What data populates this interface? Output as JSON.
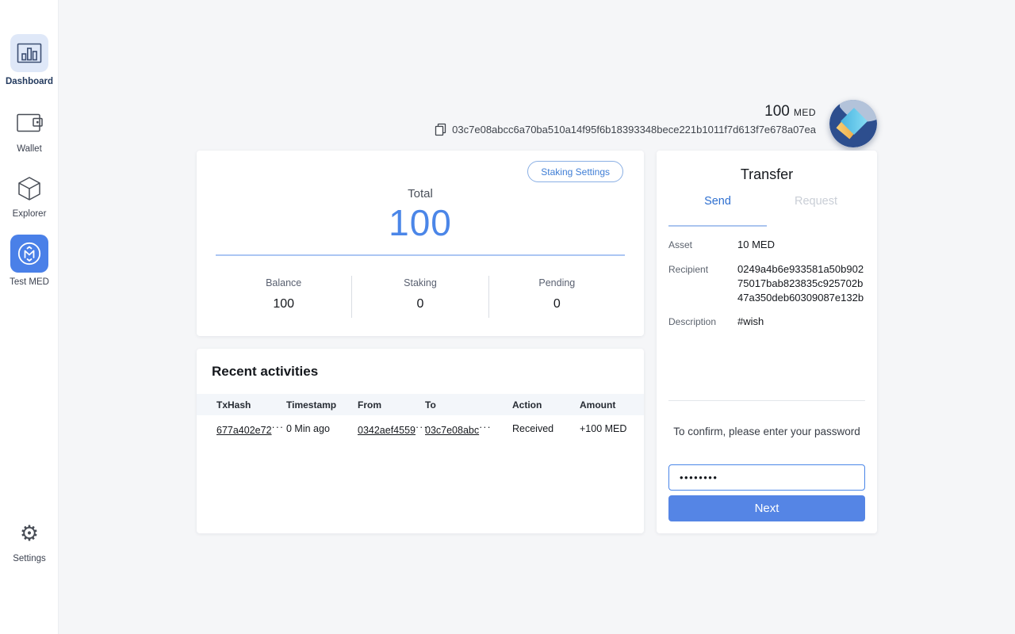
{
  "sidebar": {
    "items": [
      {
        "label": "Dashboard",
        "icon": "bar-chart-icon",
        "active": true
      },
      {
        "label": "Wallet",
        "icon": "wallet-icon"
      },
      {
        "label": "Explorer",
        "icon": "cube-icon"
      },
      {
        "label": "Test MED",
        "icon": "med-logo-icon",
        "highlight": true
      },
      {
        "label": "Settings",
        "icon": "gear-icon"
      }
    ]
  },
  "header": {
    "balance_amount": "100",
    "balance_unit": "MED",
    "account_address": "03c7e08abcc6a70ba510a14f95f6b18393348bece221b1011f7d613f7e678a07ea"
  },
  "total_card": {
    "staking_settings_label": "Staking Settings",
    "total_label": "Total",
    "total_value": "100",
    "stats": [
      {
        "label": "Balance",
        "value": "100"
      },
      {
        "label": "Staking",
        "value": "0"
      },
      {
        "label": "Pending",
        "value": "0"
      }
    ]
  },
  "activities": {
    "title": "Recent activities",
    "columns": [
      "TxHash",
      "Timestamp",
      "From",
      "To",
      "Action",
      "Amount"
    ],
    "rows": [
      {
        "txhash": "677a402e72",
        "txhash_ellipsis": "···",
        "timestamp": "0 Min ago",
        "from": "0342aef4559",
        "from_ellipsis": "···",
        "to": "03c7e08abc",
        "to_ellipsis": "···",
        "action": "Received",
        "amount": "+100 MED"
      }
    ]
  },
  "transfer": {
    "title": "Transfer",
    "tabs": [
      {
        "label": "Send",
        "active": true
      },
      {
        "label": "Request",
        "active": false
      }
    ],
    "fields": [
      {
        "label": "Asset",
        "value": "10 MED"
      },
      {
        "label": "Recipient",
        "value": "0249a4b6e933581a50b90275017bab823835c925702b47a350deb60309087e132b"
      },
      {
        "label": "Description",
        "value": "#wish"
      }
    ],
    "confirm_text": "To confirm, please enter your password",
    "password_value": "••••••••",
    "next_label": "Next"
  },
  "colors": {
    "accent_blue": "#4a86e8",
    "button_blue": "#5585e5",
    "tab_active_blue": "#2e6fd0",
    "received_green": "#2e8458",
    "logo_navy": "#2d4e8e",
    "logo_light": "#b3c3da",
    "logo_cyan": "#5cc9ec",
    "logo_orange": "#efa742",
    "page_bg": "#f5f6f8"
  }
}
